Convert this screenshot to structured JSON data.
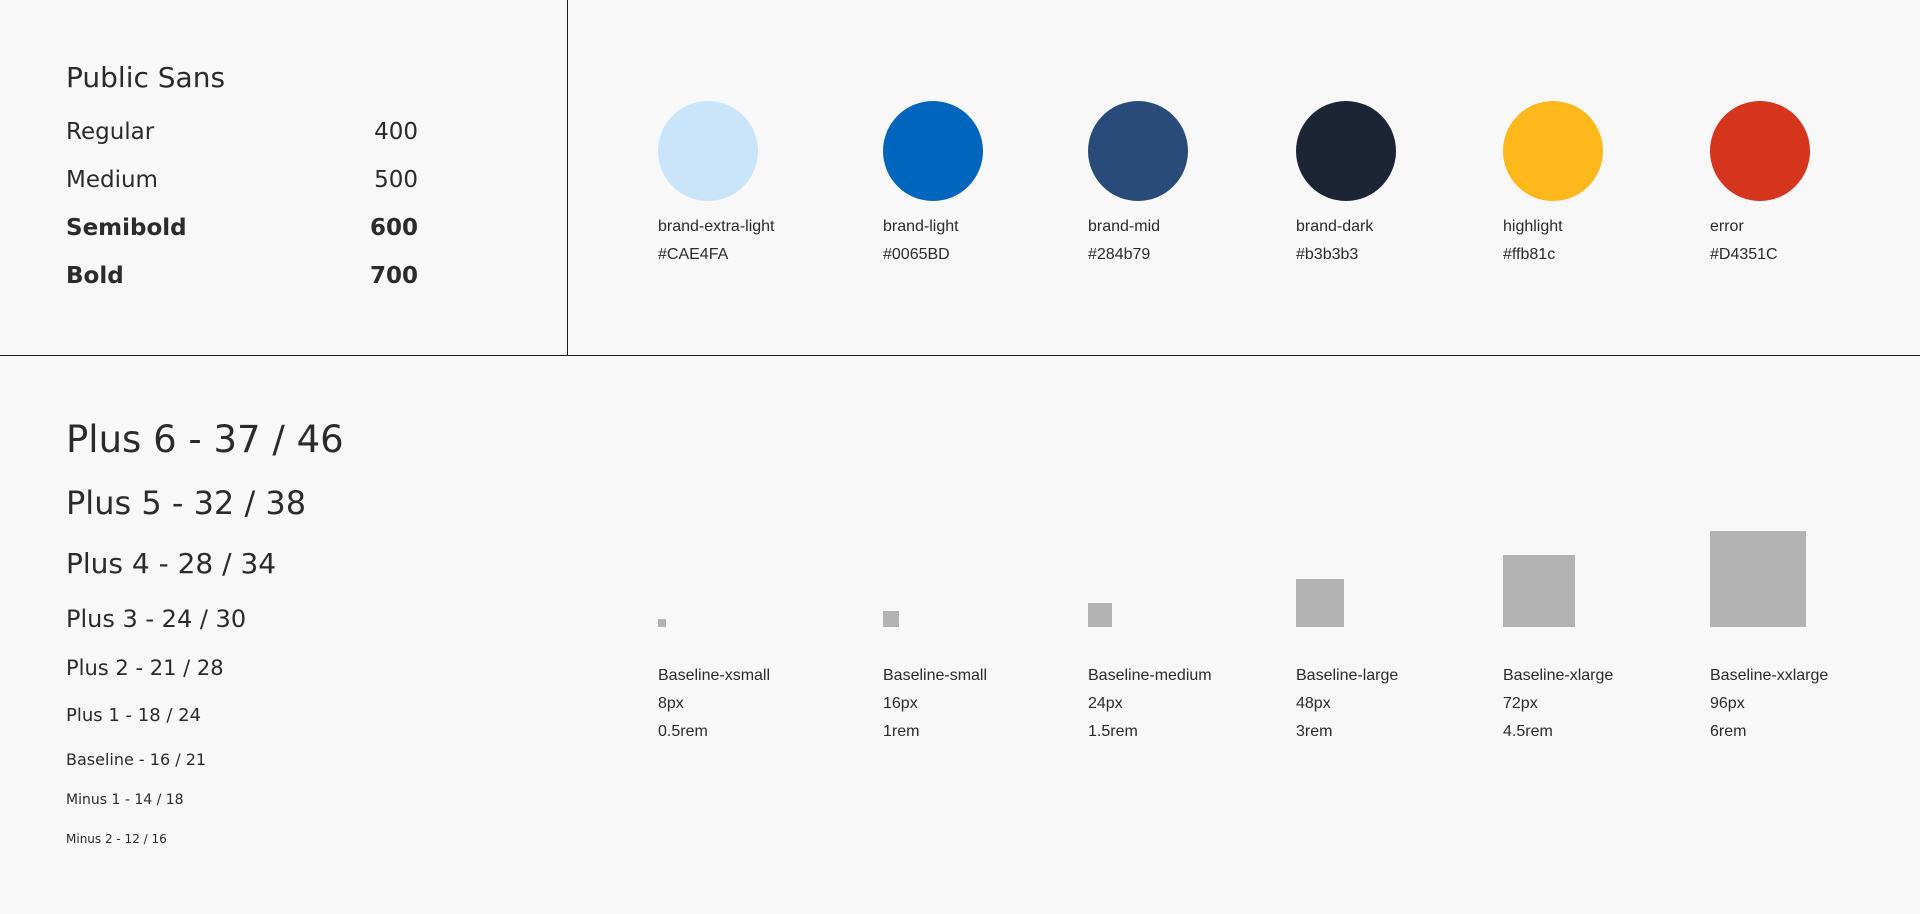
{
  "font_panel": {
    "family": "Public Sans",
    "weights": [
      {
        "name": "Regular",
        "value": "400"
      },
      {
        "name": "Medium",
        "value": "500"
      },
      {
        "name": "Semibold",
        "value": "600"
      },
      {
        "name": "Bold",
        "value": "700"
      }
    ]
  },
  "colors": [
    {
      "name": "brand-extra-light",
      "hex": "#CAE4FA",
      "swatch": "#CAE4FA"
    },
    {
      "name": "brand-light",
      "hex": "#0065BD",
      "swatch": "#0065BD"
    },
    {
      "name": "brand-mid",
      "hex": "#284b79",
      "swatch": "#284b79"
    },
    {
      "name": "brand-dark",
      "hex": "#b3b3b3",
      "swatch": "#1b2536"
    },
    {
      "name": "highlight",
      "hex": "#ffb81c",
      "swatch": "#ffb81c"
    },
    {
      "name": "error",
      "hex": "#D4351C",
      "swatch": "#D4351C"
    }
  ],
  "type_scale": [
    "Plus 6 - 37 / 46",
    "Plus 5 - 32 / 38",
    "Plus 4 - 28 / 34",
    "Plus 3 - 24 / 30",
    "Plus 2 - 21 / 28",
    "Plus 1 - 18 / 24",
    "Baseline - 16 / 21",
    "Minus 1 - 14 / 18",
    "Minus 2 - 12 / 16"
  ],
  "spacing": [
    {
      "name": "Baseline-xsmall",
      "px": "8px",
      "rem": "0.5rem"
    },
    {
      "name": "Baseline-small",
      "px": "16px",
      "rem": "1rem"
    },
    {
      "name": "Baseline-medium",
      "px": "24px",
      "rem": "1.5rem"
    },
    {
      "name": "Baseline-large",
      "px": "48px",
      "rem": "3rem"
    },
    {
      "name": "Baseline-xlarge",
      "px": "72px",
      "rem": "4.5rem"
    },
    {
      "name": "Baseline-xxlarge",
      "px": "96px",
      "rem": "6rem"
    }
  ]
}
